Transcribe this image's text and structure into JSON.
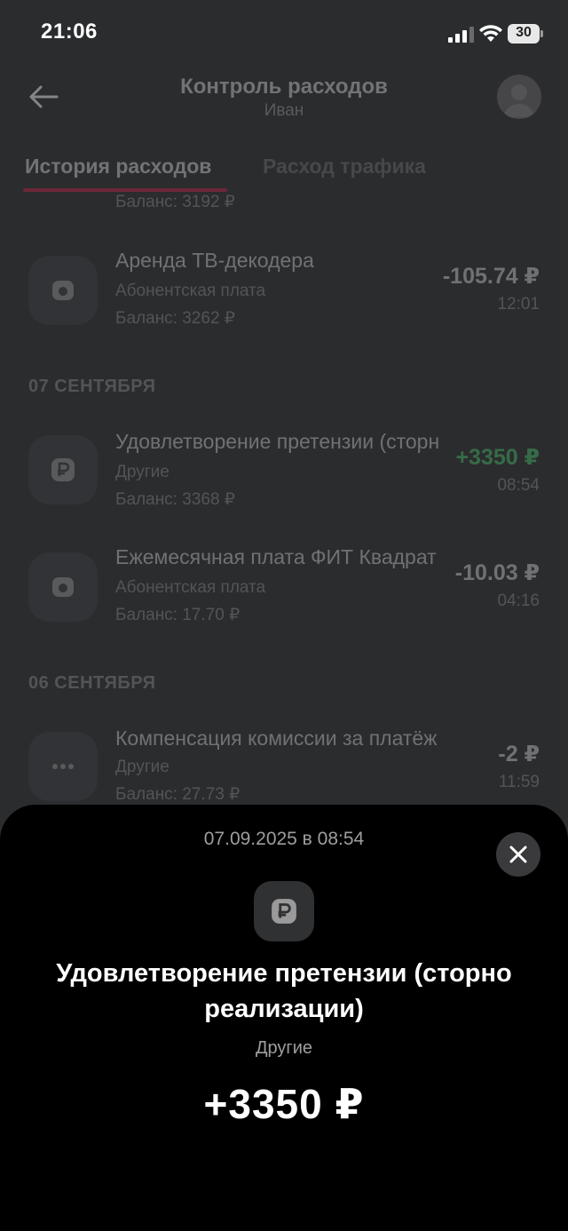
{
  "status_bar": {
    "time": "21:06",
    "battery": "30",
    "icons": [
      "signal-icon",
      "wifi-icon",
      "battery-icon"
    ]
  },
  "header": {
    "title": "Контроль расходов",
    "subtitle": "Иван",
    "back_icon": "arrow-left-icon",
    "avatar_icon": "avatar"
  },
  "tabs": [
    {
      "label": "История расходов",
      "active": true
    },
    {
      "label": "Расход трафика",
      "active": false
    }
  ],
  "list": {
    "partial_balance": "Баланс: 3192 ₽",
    "items": [
      {
        "title": "Аренда ТВ-декодера",
        "category": "Абонентская плата",
        "balance": "Баланс: 3262 ₽",
        "amount": "-105.74 ₽",
        "time": "12:01",
        "icon": "lock-icon"
      },
      {
        "title": "Удовлетворение претензии (сторно реализации)",
        "category": "Другие",
        "balance": "Баланс: 3368 ₽",
        "amount": "+3350 ₽",
        "time": "08:54",
        "icon": "ruble-icon"
      },
      {
        "title": "Ежемесячная плата ФИТ Квадрат",
        "category": "Абонентская плата",
        "balance": "Баланс: 17.70 ₽",
        "amount": "-10.03 ₽",
        "time": "04:16",
        "icon": "lock-icon"
      },
      {
        "title": "Компенсация комиссии за платёж",
        "category": "Другие",
        "balance": "Баланс: 27.73 ₽",
        "amount": "-2 ₽",
        "time": "11:59",
        "icon": "dots-icon"
      }
    ],
    "sections": [
      "07 СЕНТЯБРЯ",
      "06 СЕНТЯБРЯ"
    ]
  },
  "sheet": {
    "date": "07.09.2025 в 08:54",
    "icon": "ruble-icon",
    "title": "Удовлетворение претензии (сторно реализации)",
    "category": "Другие",
    "amount": "+3350 ₽",
    "close_icon": "close-icon"
  },
  "colors": {
    "accent": "#c7224a",
    "positive": "#46c26c",
    "sheet_bg": "#000000",
    "page_bg": "#2b2c2e"
  }
}
